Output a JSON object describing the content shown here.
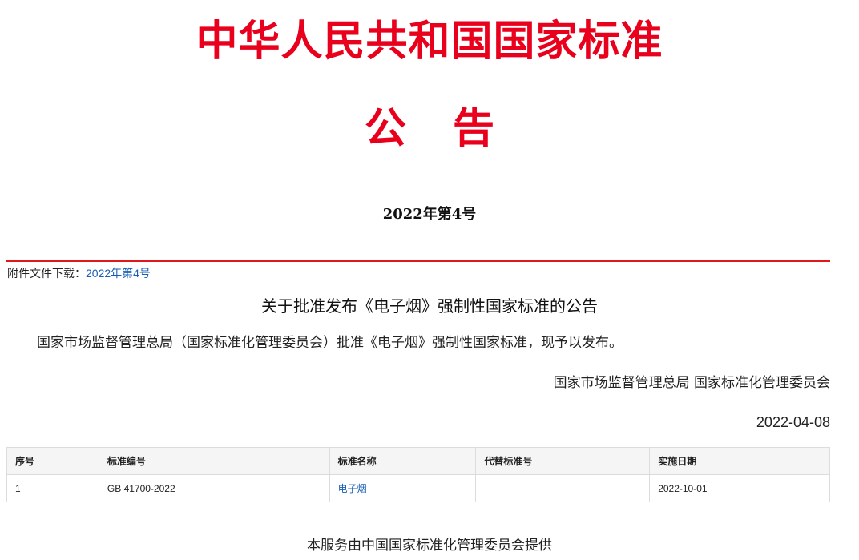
{
  "header": {
    "title": "中华人民共和国国家标准",
    "subtitle": "公  告",
    "issue": "2022年第4号"
  },
  "attachment": {
    "label": "附件文件下载：",
    "link_text": "2022年第4号"
  },
  "notice": {
    "title": "关于批准发布《电子烟》强制性国家标准的公告",
    "body": "国家市场监督管理总局（国家标准化管理委员会）批准《电子烟》强制性国家标准，现予以发布。",
    "signer": "国家市场监督管理总局 国家标准化管理委员会",
    "date": "2022-04-08"
  },
  "table": {
    "headers": [
      "序号",
      "标准编号",
      "标准名称",
      "代替标准号",
      "实施日期"
    ],
    "rows": [
      [
        "1",
        "GB 41700-2022",
        "电子烟",
        "",
        "2022-10-01"
      ]
    ]
  },
  "footer": {
    "text": "本服务由中国国家标准化管理委员会提供"
  },
  "colors": {
    "headline_red": "#e8001c",
    "link_blue": "#1a5fb4"
  }
}
